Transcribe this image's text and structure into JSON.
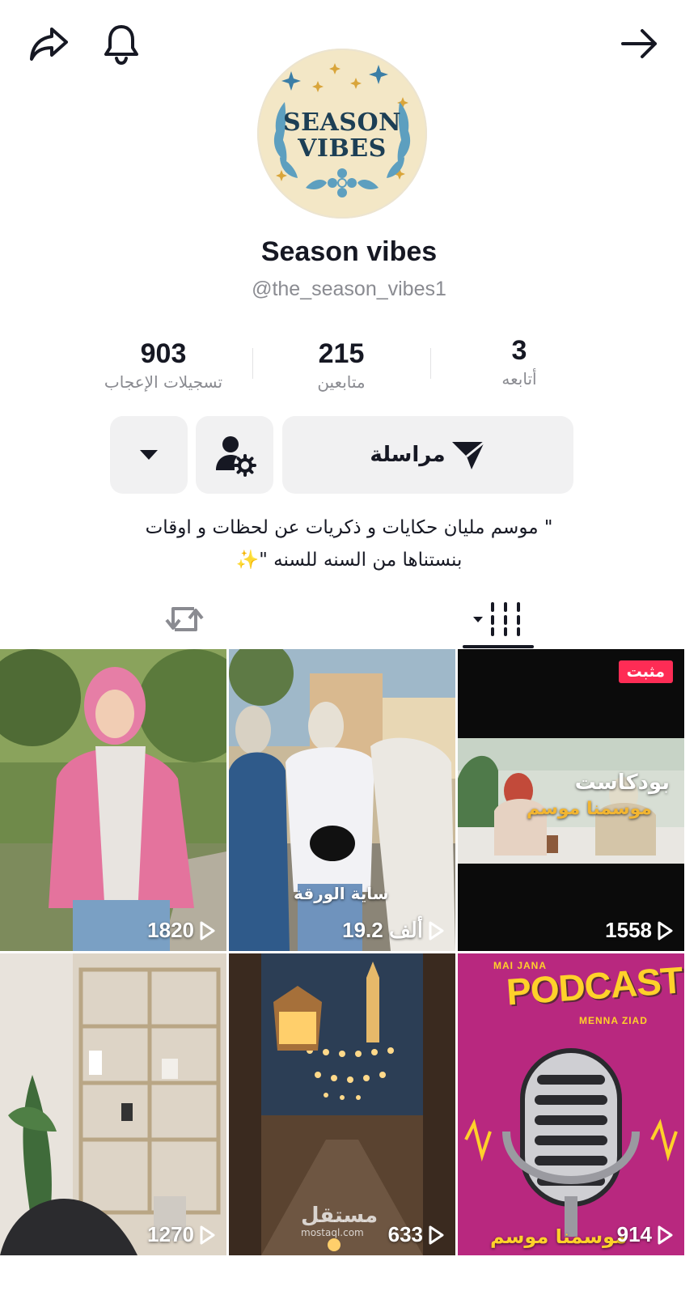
{
  "profile": {
    "logo_line1": "SEASON",
    "logo_line2": "VIBES",
    "display_name": "Season vibes",
    "handle": "@the_season_vibes1"
  },
  "stats": {
    "likes_count": "903",
    "likes_label": "تسجيلات الإعجاب",
    "followers_count": "215",
    "followers_label": "متابعين",
    "following_count": "3",
    "following_label": "أتابعه"
  },
  "actions": {
    "message_label": "مراسلة"
  },
  "bio": {
    "line1": "\" موسم مليان حكايات و ذكريات عن لحظات و اوقات",
    "line2": "بنستناها من السنه للسنه \"✨"
  },
  "videos": [
    {
      "views": "1820"
    },
    {
      "views": "19.2 ألف",
      "overlay": "ساية الورقة"
    },
    {
      "views": "1558",
      "badge": "مثبت",
      "overlay_top": "بودكاست",
      "overlay_bottom": "موسمنا موسم"
    },
    {
      "views": "1270"
    },
    {
      "views": "633"
    },
    {
      "views": "914",
      "podcast": "PODCAST",
      "tag1": "MAI JANA",
      "tag2": "MENNA ZIAD",
      "overlay": "موسمنا موسم"
    }
  ],
  "watermark": {
    "ar": "مستقل",
    "en": "mostaql.com"
  },
  "colors": {
    "accent": "#fe2c55",
    "text": "#161823",
    "muted": "#8a8b91",
    "button_bg": "#f1f1f2"
  }
}
